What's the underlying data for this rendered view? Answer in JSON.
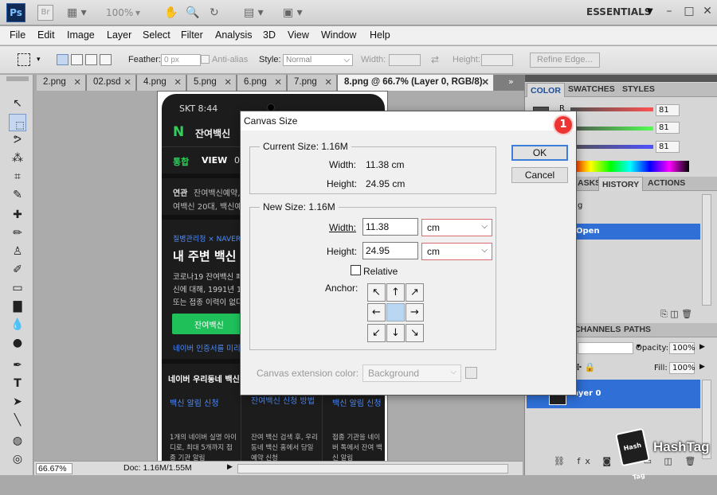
{
  "app": {
    "logo": "Ps",
    "bridge": "Br",
    "zoom": "100%",
    "workspace": "ESSENTIALS"
  },
  "menu": [
    "File",
    "Edit",
    "Image",
    "Layer",
    "Select",
    "Filter",
    "Analysis",
    "3D",
    "View",
    "Window",
    "Help"
  ],
  "options": {
    "feather_label": "Feather:",
    "feather_value": "0 px",
    "antialias": "Anti-alias",
    "style_label": "Style:",
    "style_value": "Normal",
    "width_label": "Width:",
    "height_label": "Height:",
    "refine": "Refine Edge..."
  },
  "tabs": [
    {
      "label": "2.png"
    },
    {
      "label": "02.psd"
    },
    {
      "label": "4.png"
    },
    {
      "label": "5.png"
    },
    {
      "label": "6.png"
    },
    {
      "label": "7.png"
    },
    {
      "label": "8.png @ 66.7% (Layer 0, RGB/8)"
    }
  ],
  "status": {
    "zoom": "66.67%",
    "doc": "Doc: 1.16M/1.55M"
  },
  "phone": {
    "time": "SKT 8:44",
    "logo": "N",
    "head": "잔여백신",
    "nav": [
      "통합",
      "VIEW",
      "0"
    ],
    "l1a": "연관",
    "l1b": "잔여백신예약,",
    "l2": "여백신 20대, 백신예",
    "promo": "질병관리청 × NAVER",
    "big": "내 주변 백신 찾",
    "p1": "코로나19 잔여백신 페",
    "p2": "신에 대해, 1991년 12",
    "p3": "또는 접종 이력이 없다",
    "green_btn": "잔여백신",
    "link": "네이버 인증서를 미리",
    "sec": "네이버 우리동네 백신",
    "c1t": "백신 알림 신청",
    "c2t": "잔여백신 신청 방법",
    "c3t": "백신 알림 신청",
    "c1b": "1개의 네이버 실명 아이디로, 최대 5개까지 접종 기관 알림",
    "c2b": "잔여 백신 검색 후, 우리동네 백신 홈에서 당일 예약 신청",
    "c3b": "접종 기관을 네이버 톡에서 잔여 백신 알림"
  },
  "panels": {
    "color_tabs": [
      "COLOR",
      "SWATCHES",
      "STYLES"
    ],
    "rgb": [
      {
        "ch": "R",
        "v": "81"
      },
      {
        "ch": "G",
        "v": "81"
      },
      {
        "ch": "B",
        "v": "81"
      }
    ],
    "history_tabs": [
      "ASKS",
      "HISTORY",
      "ACTIONS"
    ],
    "history_items": [
      "g",
      "Open"
    ],
    "layer_tabs": [
      "CHANNELS",
      "PATHS"
    ],
    "opacity_label": "Opacity:",
    "opacity": "100%",
    "fill_label": "Fill:",
    "fill": "100%",
    "layer_name": "Layer 0"
  },
  "dialog": {
    "title": "Canvas Size",
    "current_title": "Current Size: 1.16M",
    "cur_w_label": "Width:",
    "cur_w": "11.38 cm",
    "cur_h_label": "Height:",
    "cur_h": "24.95 cm",
    "new_title": "New Size: 1.16M",
    "w_label": "Width:",
    "w_value": "11.38",
    "w_unit": "cm",
    "h_label": "Height:",
    "h_value": "24.95",
    "h_unit": "cm",
    "relative": "Relative",
    "anchor": "Anchor:",
    "ext_label": "Canvas extension color:",
    "ext_value": "Background",
    "ok": "OK",
    "cancel": "Cancel",
    "badge": "1"
  },
  "watermark": {
    "text": "HashTag",
    "cube": "Hash Tag"
  }
}
